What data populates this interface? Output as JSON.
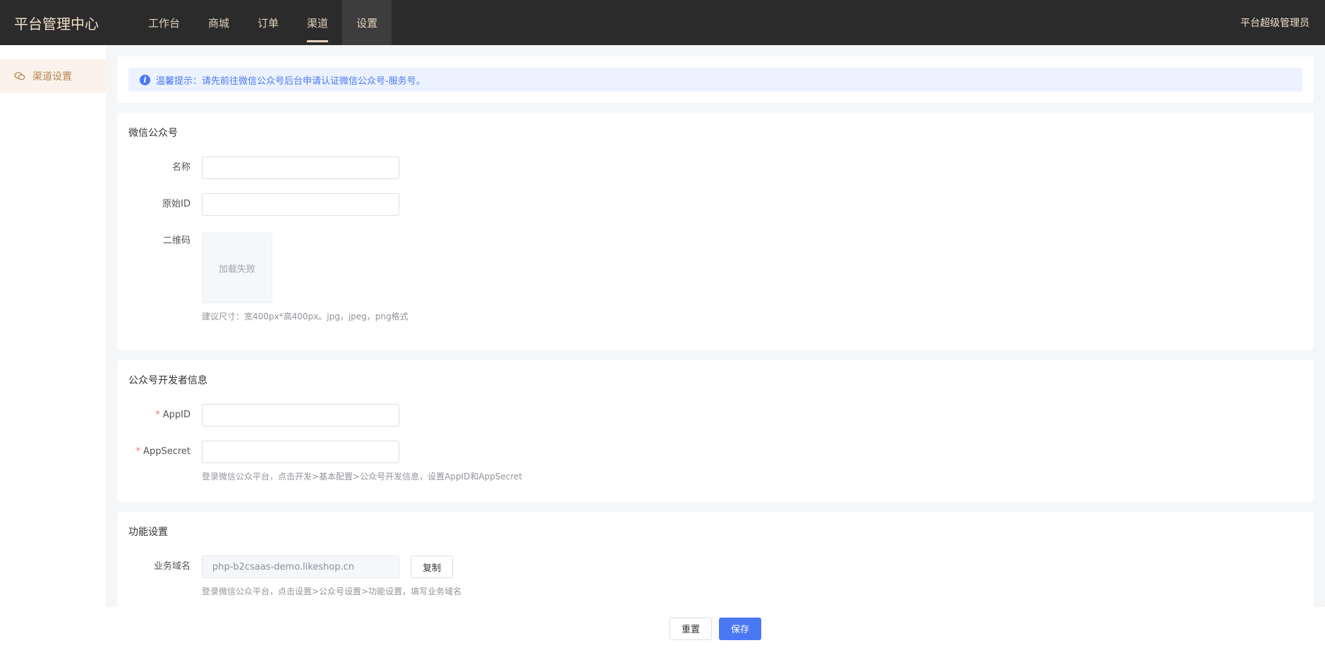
{
  "header": {
    "brand": "平台管理中心",
    "nav": [
      {
        "label": "工作台"
      },
      {
        "label": "商城"
      },
      {
        "label": "订单"
      },
      {
        "label": "渠道"
      },
      {
        "label": "设置"
      }
    ],
    "user": "平台超级管理员"
  },
  "sidebar": {
    "items": [
      {
        "label": "渠道设置"
      }
    ]
  },
  "notice": "温馨提示：请先前往微信公众号后台申请认证微信公众号-服务号。",
  "wechat": {
    "title": "微信公众号",
    "name_label": "名称",
    "name_value": "",
    "original_id_label": "原始ID",
    "original_id_value": "",
    "qrcode_label": "二维码",
    "qrcode_fail": "加载失败",
    "qrcode_hint": "建议尺寸：宽400px*高400px。jpg，jpeg，png格式"
  },
  "developer": {
    "title": "公众号开发者信息",
    "appid_label": "AppID",
    "appid_value": "",
    "appsecret_label": "AppSecret",
    "appsecret_value": "",
    "hint": "登录微信公众平台，点击开发>基本配置>公众号开发信息，设置AppID和AppSecret"
  },
  "function": {
    "title": "功能设置",
    "domain_label": "业务域名",
    "domain_value": "php-b2csaas-demo.likeshop.cn",
    "copy_label": "复制",
    "hint": "登录微信公众平台，点击设置>公众号设置>功能设置，填写业务域名"
  },
  "footer": {
    "reset_label": "重置",
    "save_label": "保存"
  },
  "colors": {
    "accent": "#4a78f5",
    "topbar": "#2b2b2b",
    "brand_text": "#f2e0cb",
    "required": "#f56c6c"
  }
}
